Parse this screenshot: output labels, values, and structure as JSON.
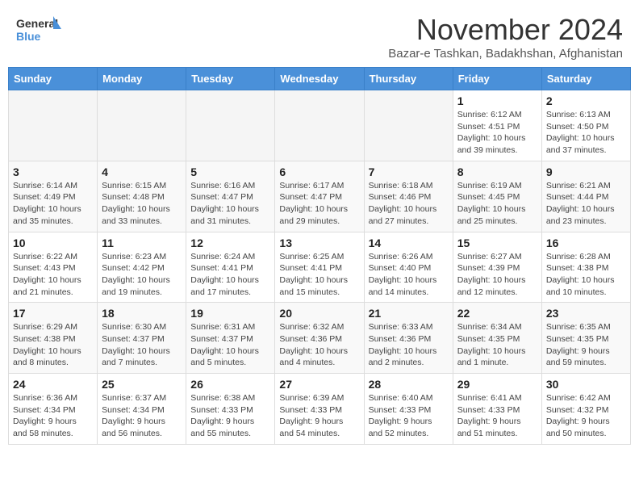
{
  "logo": {
    "line1": "General",
    "line2": "Blue"
  },
  "title": "November 2024",
  "subtitle": "Bazar-e Tashkan, Badakhshan, Afghanistan",
  "days_of_week": [
    "Sunday",
    "Monday",
    "Tuesday",
    "Wednesday",
    "Thursday",
    "Friday",
    "Saturday"
  ],
  "weeks": [
    [
      {
        "day": "",
        "info": ""
      },
      {
        "day": "",
        "info": ""
      },
      {
        "day": "",
        "info": ""
      },
      {
        "day": "",
        "info": ""
      },
      {
        "day": "",
        "info": ""
      },
      {
        "day": "1",
        "info": "Sunrise: 6:12 AM\nSunset: 4:51 PM\nDaylight: 10 hours and 39 minutes."
      },
      {
        "day": "2",
        "info": "Sunrise: 6:13 AM\nSunset: 4:50 PM\nDaylight: 10 hours and 37 minutes."
      }
    ],
    [
      {
        "day": "3",
        "info": "Sunrise: 6:14 AM\nSunset: 4:49 PM\nDaylight: 10 hours and 35 minutes."
      },
      {
        "day": "4",
        "info": "Sunrise: 6:15 AM\nSunset: 4:48 PM\nDaylight: 10 hours and 33 minutes."
      },
      {
        "day": "5",
        "info": "Sunrise: 6:16 AM\nSunset: 4:47 PM\nDaylight: 10 hours and 31 minutes."
      },
      {
        "day": "6",
        "info": "Sunrise: 6:17 AM\nSunset: 4:47 PM\nDaylight: 10 hours and 29 minutes."
      },
      {
        "day": "7",
        "info": "Sunrise: 6:18 AM\nSunset: 4:46 PM\nDaylight: 10 hours and 27 minutes."
      },
      {
        "day": "8",
        "info": "Sunrise: 6:19 AM\nSunset: 4:45 PM\nDaylight: 10 hours and 25 minutes."
      },
      {
        "day": "9",
        "info": "Sunrise: 6:21 AM\nSunset: 4:44 PM\nDaylight: 10 hours and 23 minutes."
      }
    ],
    [
      {
        "day": "10",
        "info": "Sunrise: 6:22 AM\nSunset: 4:43 PM\nDaylight: 10 hours and 21 minutes."
      },
      {
        "day": "11",
        "info": "Sunrise: 6:23 AM\nSunset: 4:42 PM\nDaylight: 10 hours and 19 minutes."
      },
      {
        "day": "12",
        "info": "Sunrise: 6:24 AM\nSunset: 4:41 PM\nDaylight: 10 hours and 17 minutes."
      },
      {
        "day": "13",
        "info": "Sunrise: 6:25 AM\nSunset: 4:41 PM\nDaylight: 10 hours and 15 minutes."
      },
      {
        "day": "14",
        "info": "Sunrise: 6:26 AM\nSunset: 4:40 PM\nDaylight: 10 hours and 14 minutes."
      },
      {
        "day": "15",
        "info": "Sunrise: 6:27 AM\nSunset: 4:39 PM\nDaylight: 10 hours and 12 minutes."
      },
      {
        "day": "16",
        "info": "Sunrise: 6:28 AM\nSunset: 4:38 PM\nDaylight: 10 hours and 10 minutes."
      }
    ],
    [
      {
        "day": "17",
        "info": "Sunrise: 6:29 AM\nSunset: 4:38 PM\nDaylight: 10 hours and 8 minutes."
      },
      {
        "day": "18",
        "info": "Sunrise: 6:30 AM\nSunset: 4:37 PM\nDaylight: 10 hours and 7 minutes."
      },
      {
        "day": "19",
        "info": "Sunrise: 6:31 AM\nSunset: 4:37 PM\nDaylight: 10 hours and 5 minutes."
      },
      {
        "day": "20",
        "info": "Sunrise: 6:32 AM\nSunset: 4:36 PM\nDaylight: 10 hours and 4 minutes."
      },
      {
        "day": "21",
        "info": "Sunrise: 6:33 AM\nSunset: 4:36 PM\nDaylight: 10 hours and 2 minutes."
      },
      {
        "day": "22",
        "info": "Sunrise: 6:34 AM\nSunset: 4:35 PM\nDaylight: 10 hours and 1 minute."
      },
      {
        "day": "23",
        "info": "Sunrise: 6:35 AM\nSunset: 4:35 PM\nDaylight: 9 hours and 59 minutes."
      }
    ],
    [
      {
        "day": "24",
        "info": "Sunrise: 6:36 AM\nSunset: 4:34 PM\nDaylight: 9 hours and 58 minutes."
      },
      {
        "day": "25",
        "info": "Sunrise: 6:37 AM\nSunset: 4:34 PM\nDaylight: 9 hours and 56 minutes."
      },
      {
        "day": "26",
        "info": "Sunrise: 6:38 AM\nSunset: 4:33 PM\nDaylight: 9 hours and 55 minutes."
      },
      {
        "day": "27",
        "info": "Sunrise: 6:39 AM\nSunset: 4:33 PM\nDaylight: 9 hours and 54 minutes."
      },
      {
        "day": "28",
        "info": "Sunrise: 6:40 AM\nSunset: 4:33 PM\nDaylight: 9 hours and 52 minutes."
      },
      {
        "day": "29",
        "info": "Sunrise: 6:41 AM\nSunset: 4:33 PM\nDaylight: 9 hours and 51 minutes."
      },
      {
        "day": "30",
        "info": "Sunrise: 6:42 AM\nSunset: 4:32 PM\nDaylight: 9 hours and 50 minutes."
      }
    ]
  ],
  "colors": {
    "header_bg": "#4a90d9",
    "header_text": "#ffffff",
    "border": "#dddddd"
  }
}
